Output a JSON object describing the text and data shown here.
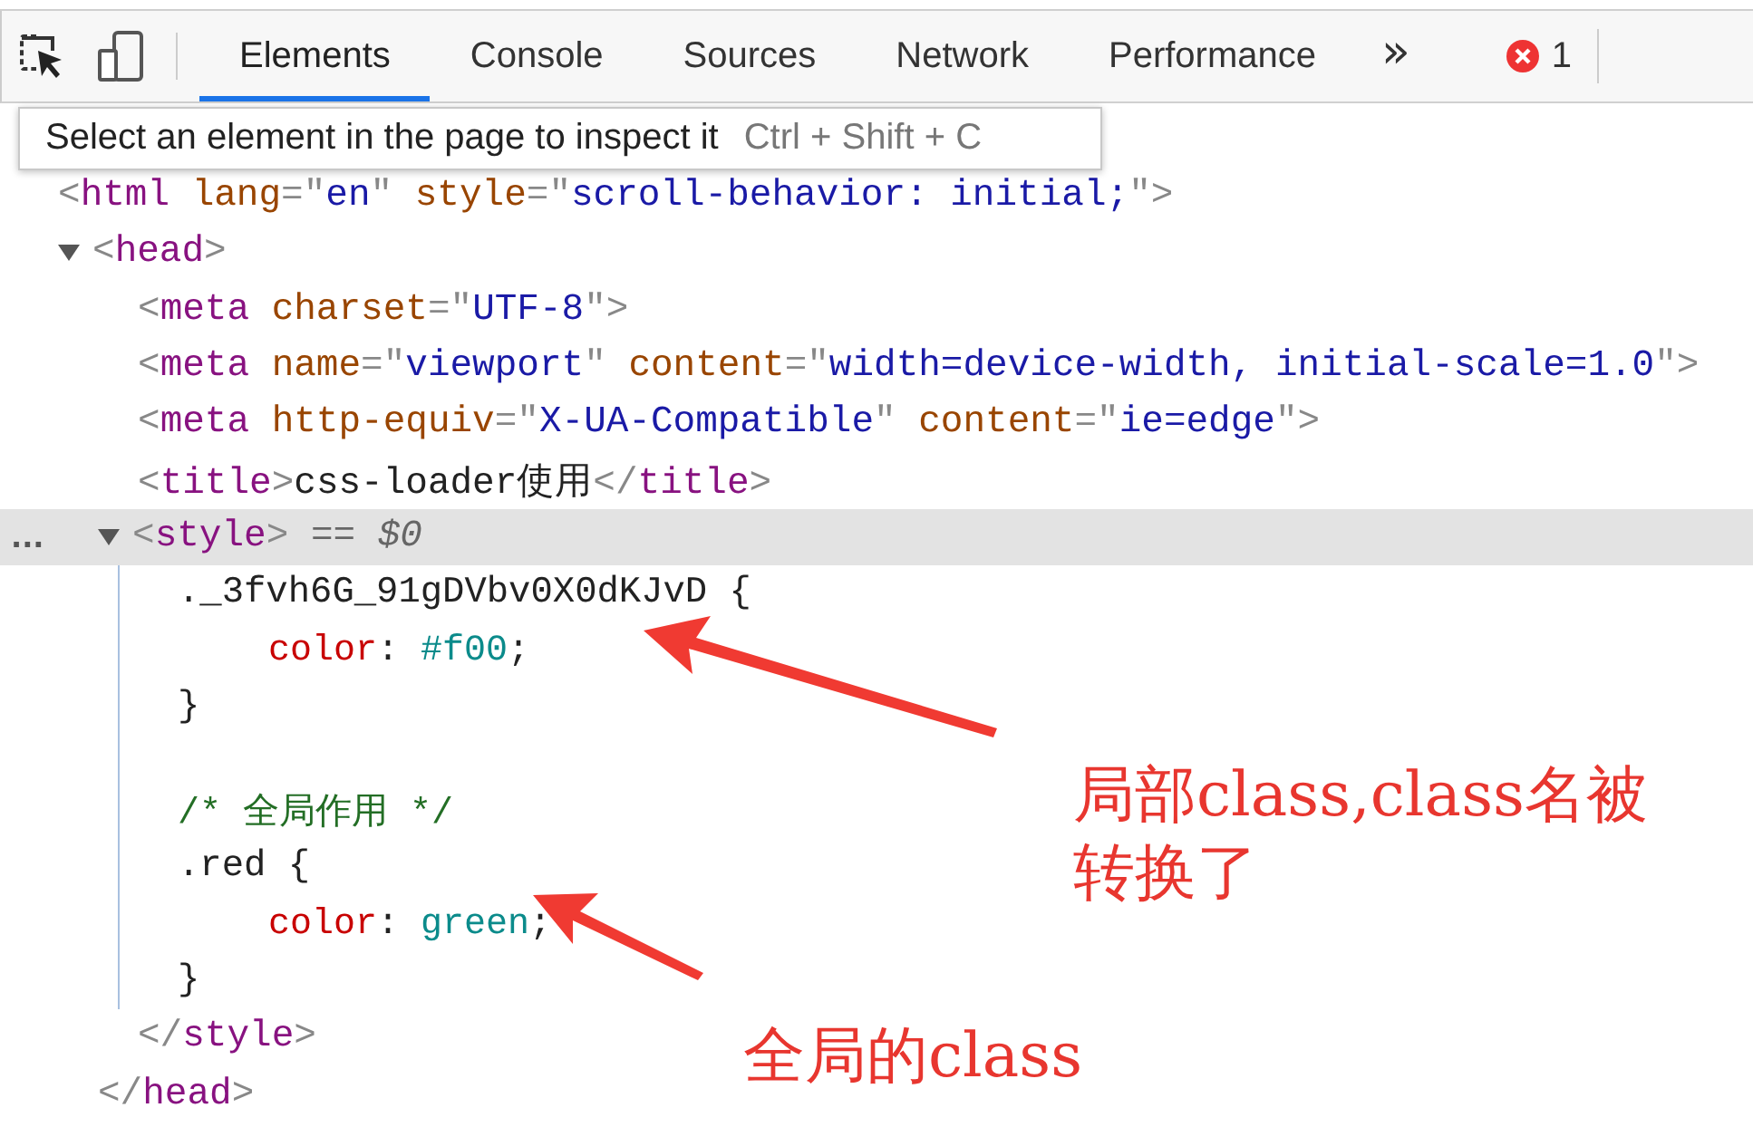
{
  "toolbar": {
    "tools": [
      {
        "kind": "inspect"
      },
      {
        "kind": "device"
      }
    ],
    "tabs": [
      {
        "label": "Elements",
        "selected": true
      },
      {
        "label": "Console",
        "selected": false
      },
      {
        "label": "Sources",
        "selected": false
      },
      {
        "label": "Network",
        "selected": false
      },
      {
        "label": "Performance",
        "selected": false
      }
    ],
    "more": "»",
    "errors": {
      "count": "1"
    }
  },
  "tooltip": {
    "text": "Select an element in the page to inspect it",
    "shortcut": "Ctrl + Shift + C"
  },
  "dom_tree": [
    {
      "kind": "element",
      "selected": false,
      "tokens": [
        {
          "kind": "punct",
          "s": "<"
        },
        {
          "kind": "tag",
          "s": "html"
        },
        {
          "kind": "attr",
          "s": " lang"
        },
        {
          "kind": "punct",
          "s": "=\""
        },
        {
          "kind": "value",
          "s": "en"
        },
        {
          "kind": "punct",
          "s": "\""
        },
        {
          "kind": "attr",
          "s": " style"
        },
        {
          "kind": "punct",
          "s": "=\""
        },
        {
          "kind": "value",
          "s": "scroll-behavior: initial;"
        },
        {
          "kind": "punct",
          "s": "\">"
        }
      ],
      "children": [
        {
          "kind": "element",
          "expanded": true,
          "selected": false,
          "tokens": [
            {
              "kind": "punct",
              "s": "<"
            },
            {
              "kind": "tag",
              "s": "head"
            },
            {
              "kind": "punct",
              "s": ">"
            }
          ],
          "close": [
            {
              "kind": "punct",
              "s": "</"
            },
            {
              "kind": "tag",
              "s": "head"
            },
            {
              "kind": "punct",
              "s": ">"
            }
          ],
          "children": [
            {
              "kind": "element",
              "selected": false,
              "tokens": [
                {
                  "kind": "punct",
                  "s": "<"
                },
                {
                  "kind": "tag",
                  "s": "meta"
                },
                {
                  "kind": "attr",
                  "s": " charset"
                },
                {
                  "kind": "punct",
                  "s": "=\""
                },
                {
                  "kind": "value",
                  "s": "UTF-8"
                },
                {
                  "kind": "punct",
                  "s": "\">"
                }
              ]
            },
            {
              "kind": "element",
              "selected": false,
              "tokens": [
                {
                  "kind": "punct",
                  "s": "<"
                },
                {
                  "kind": "tag",
                  "s": "meta"
                },
                {
                  "kind": "attr",
                  "s": " name"
                },
                {
                  "kind": "punct",
                  "s": "=\""
                },
                {
                  "kind": "value",
                  "s": "viewport"
                },
                {
                  "kind": "punct",
                  "s": "\""
                },
                {
                  "kind": "attr",
                  "s": " content"
                },
                {
                  "kind": "punct",
                  "s": "=\""
                },
                {
                  "kind": "value",
                  "s": "width=device-width, initial-scale=1.0"
                },
                {
                  "kind": "punct",
                  "s": "\">"
                }
              ]
            },
            {
              "kind": "element",
              "selected": false,
              "tokens": [
                {
                  "kind": "punct",
                  "s": "<"
                },
                {
                  "kind": "tag",
                  "s": "meta"
                },
                {
                  "kind": "attr",
                  "s": " http-equiv"
                },
                {
                  "kind": "punct",
                  "s": "=\""
                },
                {
                  "kind": "value",
                  "s": "X-UA-Compatible"
                },
                {
                  "kind": "punct",
                  "s": "\""
                },
                {
                  "kind": "attr",
                  "s": " content"
                },
                {
                  "kind": "punct",
                  "s": "=\""
                },
                {
                  "kind": "value",
                  "s": "ie=edge"
                },
                {
                  "kind": "punct",
                  "s": "\">"
                }
              ]
            },
            {
              "kind": "element",
              "selected": false,
              "tokens": [
                {
                  "kind": "punct",
                  "s": "<"
                },
                {
                  "kind": "tag",
                  "s": "title"
                },
                {
                  "kind": "punct",
                  "s": ">"
                },
                {
                  "kind": "text",
                  "s": "css-loader使用"
                },
                {
                  "kind": "punct",
                  "s": "</"
                },
                {
                  "kind": "tag",
                  "s": "title"
                },
                {
                  "kind": "punct",
                  "s": ">"
                }
              ]
            },
            {
              "kind": "element",
              "expanded": true,
              "selected": true,
              "marker": "...",
              "tokens": [
                {
                  "kind": "punct",
                  "s": "<"
                },
                {
                  "kind": "tag",
                  "s": "style"
                },
                {
                  "kind": "punct",
                  "s": ">"
                },
                {
                  "kind": "ref",
                  "s": " == $0"
                }
              ],
              "close": [
                {
                  "kind": "punct",
                  "s": "</"
                },
                {
                  "kind": "tag",
                  "s": "style"
                },
                {
                  "kind": "punct",
                  "s": ">"
                }
              ],
              "children": [
                {
                  "kind": "rule",
                  "selected": false,
                  "tokens": [
                    {
                      "kind": "text",
                      "s": "._3fvh6G_91gDVbv0X0dKJvD {"
                    }
                  ],
                  "close": [
                    {
                      "kind": "text",
                      "s": "}"
                    }
                  ],
                  "children": [
                    {
                      "kind": "decl",
                      "selected": false,
                      "tokens": [
                        {
                          "kind": "prop",
                          "s": "color"
                        },
                        {
                          "kind": "text",
                          "s": ": "
                        },
                        {
                          "kind": "cssval",
                          "s": "#f00"
                        },
                        {
                          "kind": "text",
                          "s": ";"
                        }
                      ]
                    }
                  ]
                },
                {
                  "kind": "comment",
                  "selected": false,
                  "tokens": [
                    {
                      "kind": "comment",
                      "s": "/* 全局作用 */"
                    }
                  ]
                },
                {
                  "kind": "rule",
                  "selected": false,
                  "tokens": [
                    {
                      "kind": "text",
                      "s": ".red {"
                    }
                  ],
                  "close": [
                    {
                      "kind": "text",
                      "s": "}"
                    }
                  ],
                  "children": [
                    {
                      "kind": "decl",
                      "selected": false,
                      "tokens": [
                        {
                          "kind": "prop",
                          "s": "color"
                        },
                        {
                          "kind": "text",
                          "s": ": "
                        },
                        {
                          "kind": "cssval",
                          "s": "green"
                        },
                        {
                          "kind": "text",
                          "s": ";"
                        }
                      ]
                    }
                  ]
                }
              ]
            }
          ]
        }
      ]
    }
  ],
  "annotations": [
    {
      "text": "局部class,class名被转换了"
    },
    {
      "text": "全局的class"
    }
  ]
}
